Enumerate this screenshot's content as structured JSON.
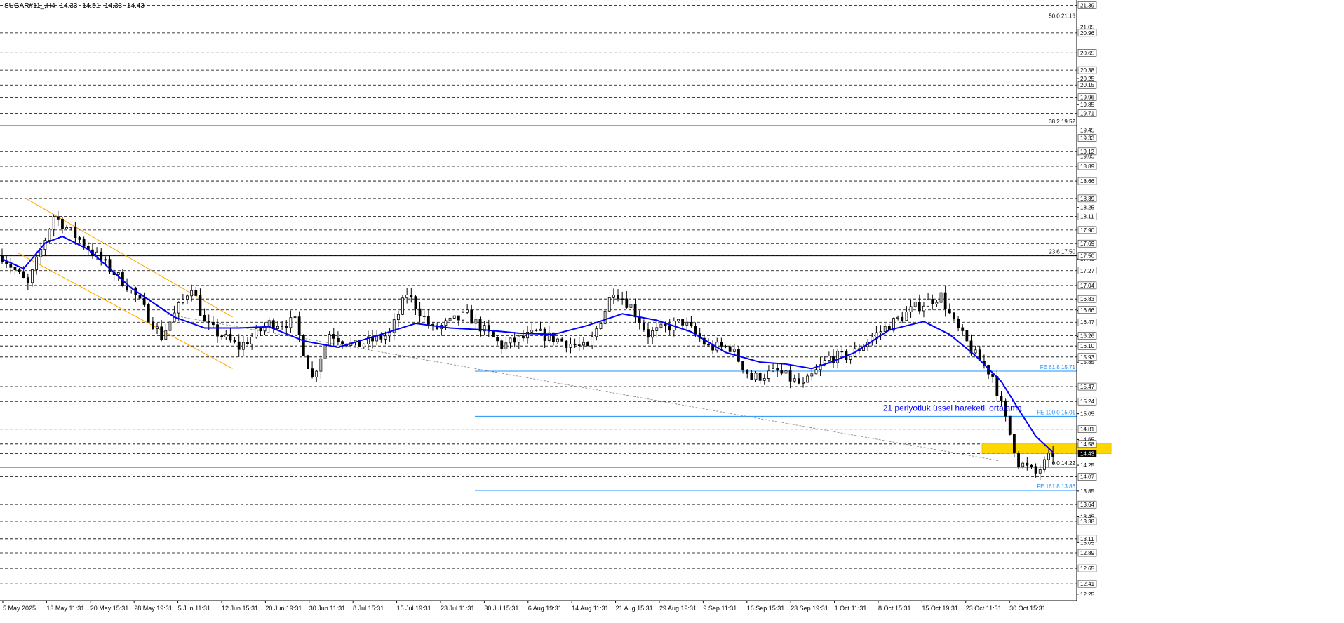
{
  "header": {
    "symbol": "SUGAR#11_,H4",
    "open": "14.33",
    "high": "14.51",
    "low": "14.33",
    "close": "14.43"
  },
  "colors": {
    "background": "#ffffff",
    "grid": "#000000",
    "candle": "#000000",
    "ema": "#0000ff",
    "channel": "#ffa500",
    "fe_levels": "#1e90ff",
    "fib_levels": "#000000",
    "highlight_zone": "#ffd700",
    "trendline": "#808080"
  },
  "chart_data": {
    "type": "candlestick",
    "title": "",
    "xlabel": "",
    "ylabel": "",
    "ylim": [
      12.15,
      21.47
    ],
    "grid": "dashed horizontal",
    "price_labels": [
      "21.39",
      "20.96",
      "20.65",
      "20.38",
      "20.15",
      "19.96",
      "19.71",
      "19.33",
      "19.12",
      "18.89",
      "18.66",
      "18.39",
      "18.11",
      "17.90",
      "17.69",
      "17.50",
      "17.27",
      "17.04",
      "16.83",
      "16.66",
      "16.47",
      "16.26",
      "16.10",
      "15.93",
      "15.47",
      "15.24",
      "14.81",
      "14.58",
      "14.43",
      "14.07",
      "13.64",
      "13.38",
      "13.11",
      "12.89",
      "12.65",
      "12.41"
    ],
    "minor_price_labels": [
      "21.05",
      "20.25",
      "19.85",
      "19.45",
      "19.05",
      "18.25",
      "17.45",
      "16.65",
      "16.25",
      "15.85",
      "15.05",
      "14.65",
      "14.25",
      "13.85",
      "13.45",
      "13.05",
      "12.25"
    ],
    "time_labels": [
      "5 May 2025",
      "13 May 11:31",
      "20 May 15:31",
      "28 May 19:31",
      "5 Jun 11:31",
      "12 Jun 15:31",
      "20 Jun 19:31",
      "30 Jun 11:31",
      "8 Jul 15:31",
      "15 Jul 19:31",
      "23 Jul 11:31",
      "30 Jul 15:31",
      "6 Aug 19:31",
      "14 Aug 11:31",
      "21 Aug 15:31",
      "29 Aug 19:31",
      "9 Sep 11:31",
      "16 Sep 15:31",
      "23 Sep 19:31",
      "1 Oct 11:31",
      "8 Oct 15:31",
      "15 Oct 19:31",
      "23 Oct 11:31",
      "30 Oct 15:31"
    ],
    "price_path": [
      [
        0,
        17.5
      ],
      [
        6,
        17.05
      ],
      [
        12,
        18.12
      ],
      [
        18,
        17.75
      ],
      [
        30,
        16.98
      ],
      [
        37,
        16.25
      ],
      [
        44,
        17.04
      ],
      [
        47,
        16.45
      ],
      [
        50,
        16.3
      ],
      [
        55,
        16.08
      ],
      [
        62,
        16.45
      ],
      [
        68,
        16.47
      ],
      [
        72,
        15.6
      ],
      [
        76,
        16.3
      ],
      [
        82,
        16.1
      ],
      [
        90,
        16.28
      ],
      [
        94,
        16.92
      ],
      [
        100,
        16.35
      ],
      [
        108,
        16.58
      ],
      [
        116,
        16.1
      ],
      [
        124,
        16.3
      ],
      [
        130,
        16.18
      ],
      [
        136,
        16.05
      ],
      [
        142,
        16.98
      ],
      [
        146,
        16.72
      ],
      [
        150,
        16.28
      ],
      [
        158,
        16.48
      ],
      [
        164,
        16.08
      ],
      [
        169,
        16.08
      ],
      [
        174,
        15.6
      ],
      [
        180,
        15.7
      ],
      [
        186,
        15.48
      ],
      [
        192,
        15.92
      ],
      [
        197,
        15.95
      ],
      [
        202,
        16.24
      ],
      [
        212,
        16.7
      ],
      [
        218,
        16.88
      ],
      [
        221,
        16.45
      ],
      [
        226,
        15.95
      ],
      [
        230,
        15.64
      ],
      [
        233,
        14.95
      ],
      [
        236,
        14.3
      ],
      [
        240,
        14.12
      ],
      [
        244,
        14.43
      ]
    ],
    "ema21": [
      [
        0,
        17.45
      ],
      [
        5,
        17.3
      ],
      [
        10,
        17.7
      ],
      [
        14,
        17.8
      ],
      [
        20,
        17.6
      ],
      [
        30,
        17.0
      ],
      [
        40,
        16.55
      ],
      [
        47,
        16.38
      ],
      [
        55,
        16.38
      ],
      [
        62,
        16.4
      ],
      [
        70,
        16.18
      ],
      [
        78,
        16.08
      ],
      [
        88,
        16.28
      ],
      [
        96,
        16.45
      ],
      [
        104,
        16.38
      ],
      [
        112,
        16.35
      ],
      [
        120,
        16.3
      ],
      [
        128,
        16.28
      ],
      [
        136,
        16.42
      ],
      [
        144,
        16.6
      ],
      [
        152,
        16.5
      ],
      [
        160,
        16.32
      ],
      [
        168,
        16.0
      ],
      [
        176,
        15.85
      ],
      [
        182,
        15.82
      ],
      [
        188,
        15.75
      ],
      [
        192,
        15.84
      ],
      [
        198,
        16.0
      ],
      [
        206,
        16.35
      ],
      [
        214,
        16.48
      ],
      [
        220,
        16.28
      ],
      [
        226,
        15.95
      ],
      [
        232,
        15.55
      ],
      [
        236,
        15.12
      ],
      [
        240,
        14.7
      ],
      [
        244,
        14.45
      ]
    ],
    "channel": {
      "upper": [
        [
          6,
          18.39
        ],
        [
          54,
          16.55
        ]
      ],
      "lower": [
        [
          4,
          17.55
        ],
        [
          54,
          15.75
        ]
      ]
    },
    "trendline": [
      [
        38,
        16.6
      ],
      [
        232,
        14.32
      ]
    ],
    "fib_levels": [
      {
        "label": "50.0 21.16",
        "price": 21.16
      },
      {
        "label": "38.2 19.52",
        "price": 19.52
      },
      {
        "label": "23.6 17.50",
        "price": 17.5
      },
      {
        "label": "0.0 14.22",
        "price": 14.22
      }
    ],
    "fe_levels": [
      {
        "label": "FE 61.8 15.71",
        "price": 15.71
      },
      {
        "label": "FE 100.0 15.01",
        "price": 15.01
      },
      {
        "label": "FE 161.8 13.86",
        "price": 13.86
      }
    ],
    "zone": {
      "from_bar": 228,
      "to_bar": 258,
      "low": 14.43,
      "high": 14.59
    },
    "annotations": [
      {
        "text": "21 periyotluk üssel hareketli ortalama",
        "price": 15.05,
        "bar": 205
      }
    ],
    "current_price": "14.43"
  }
}
